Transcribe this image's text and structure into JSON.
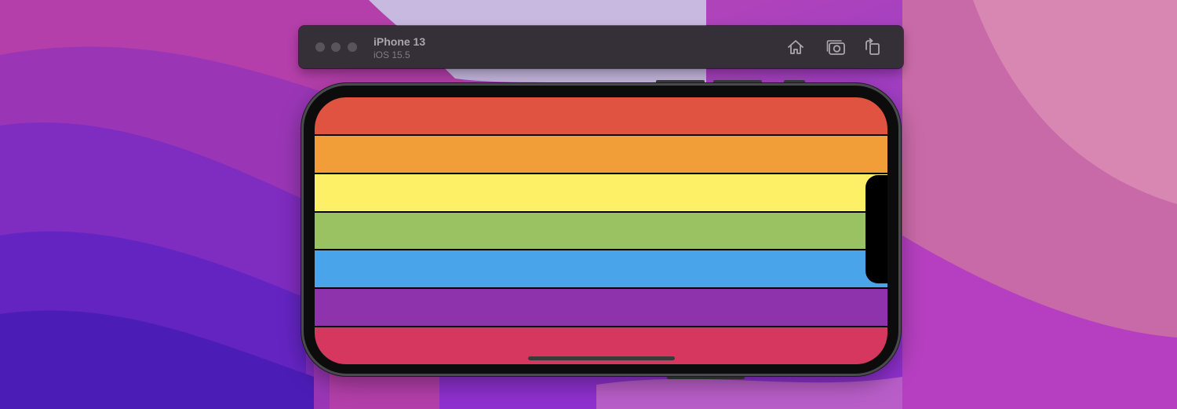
{
  "window": {
    "device_name": "iPhone 13",
    "os_version": "iOS 15.5"
  },
  "toolbar": {
    "buttons": [
      {
        "name": "home-button",
        "icon": "home-icon"
      },
      {
        "name": "screenshot-button",
        "icon": "camera-icon"
      },
      {
        "name": "rotate-button",
        "icon": "rotate-icon"
      }
    ]
  },
  "screen": {
    "stripes": [
      {
        "name": "red",
        "color": "#e15341"
      },
      {
        "name": "orange",
        "color": "#f19d38"
      },
      {
        "name": "yellow",
        "color": "#fdef66"
      },
      {
        "name": "green",
        "color": "#9ac262"
      },
      {
        "name": "blue",
        "color": "#4aa4ea"
      },
      {
        "name": "purple",
        "color": "#8e33ab"
      },
      {
        "name": "pink",
        "color": "#d5375f"
      }
    ]
  },
  "colors": {
    "toolbar_bg": "#353037",
    "traffic_light": "#58545a",
    "phone_body": "#0c0c0d",
    "home_indicator": "#3a3a3c"
  }
}
